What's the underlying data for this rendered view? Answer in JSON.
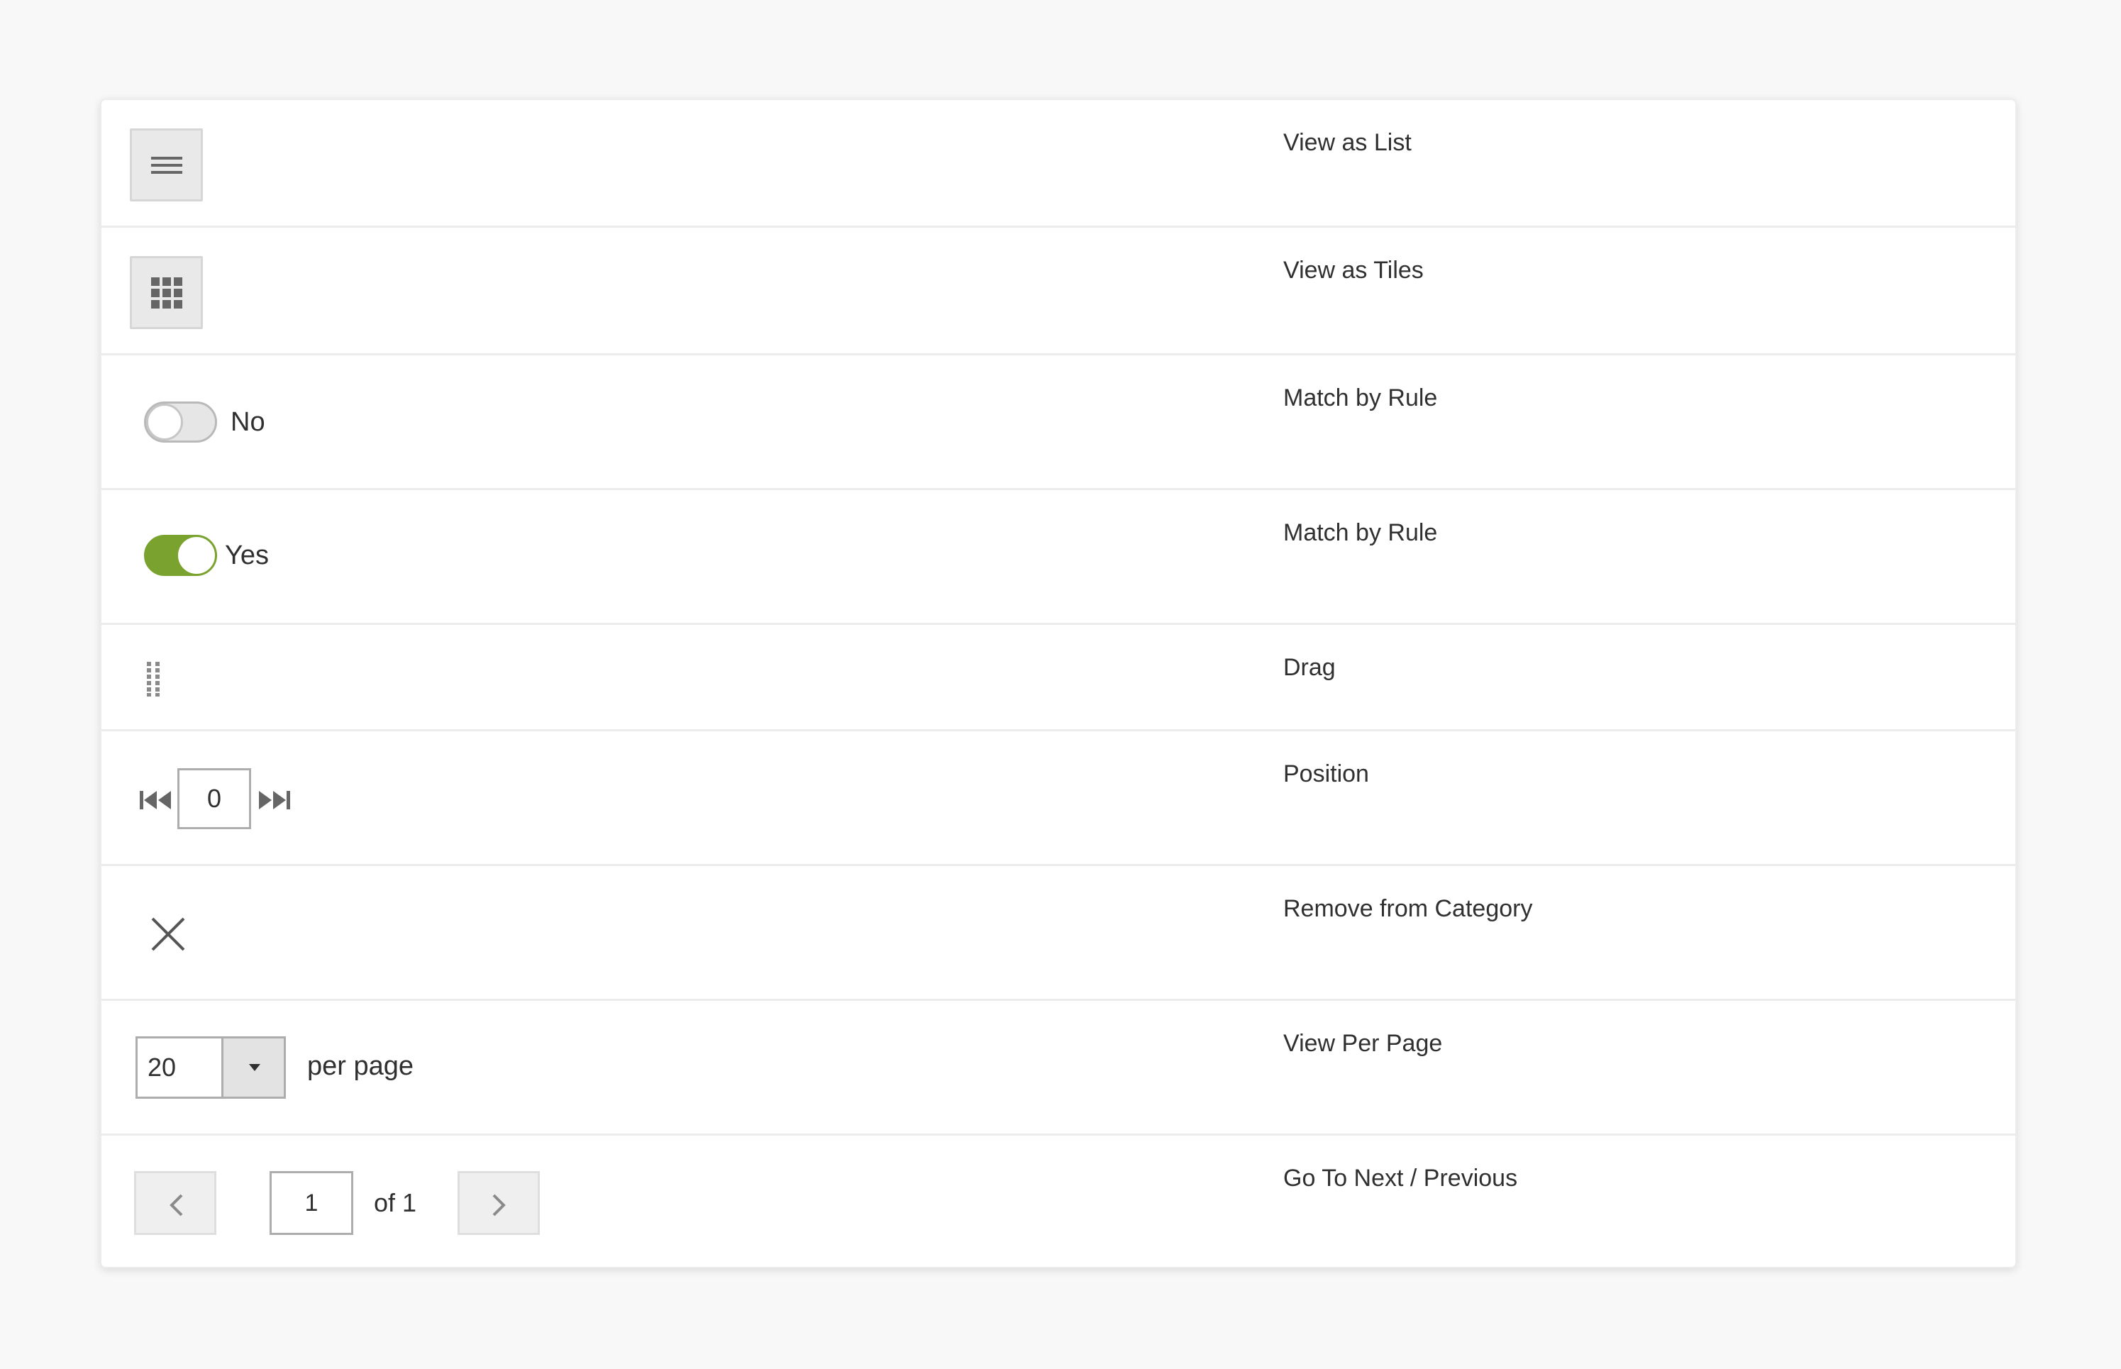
{
  "rows": {
    "view_list": {
      "label": "View as List",
      "icon": "list-icon"
    },
    "view_tiles": {
      "label": "View as Tiles",
      "icon": "grid-icon"
    },
    "match_no": {
      "label": "Match by Rule",
      "switch_text": "No",
      "state": "off"
    },
    "match_yes": {
      "label": "Match by Rule",
      "switch_text": "Yes",
      "state": "on"
    },
    "drag": {
      "label": "Drag",
      "icon": "drag-handle-icon"
    },
    "position": {
      "label": "Position",
      "value": "0",
      "first_icon": "first-position-icon",
      "last_icon": "last-position-icon"
    },
    "remove": {
      "label": "Remove from Category",
      "icon": "close-icon"
    },
    "per_page": {
      "label": "View Per Page",
      "value": "20",
      "suffix": "per page",
      "icon": "caret-down-icon"
    },
    "pager": {
      "label": "Go To Next / Previous",
      "page": "1",
      "of_text": "of 1",
      "prev_icon": "chevron-left-icon",
      "next_icon": "chevron-right-icon"
    }
  },
  "colors": {
    "switch_on": "#79a22e",
    "border": "#adadad",
    "icon": "#6f6f6f",
    "text": "#303030"
  }
}
